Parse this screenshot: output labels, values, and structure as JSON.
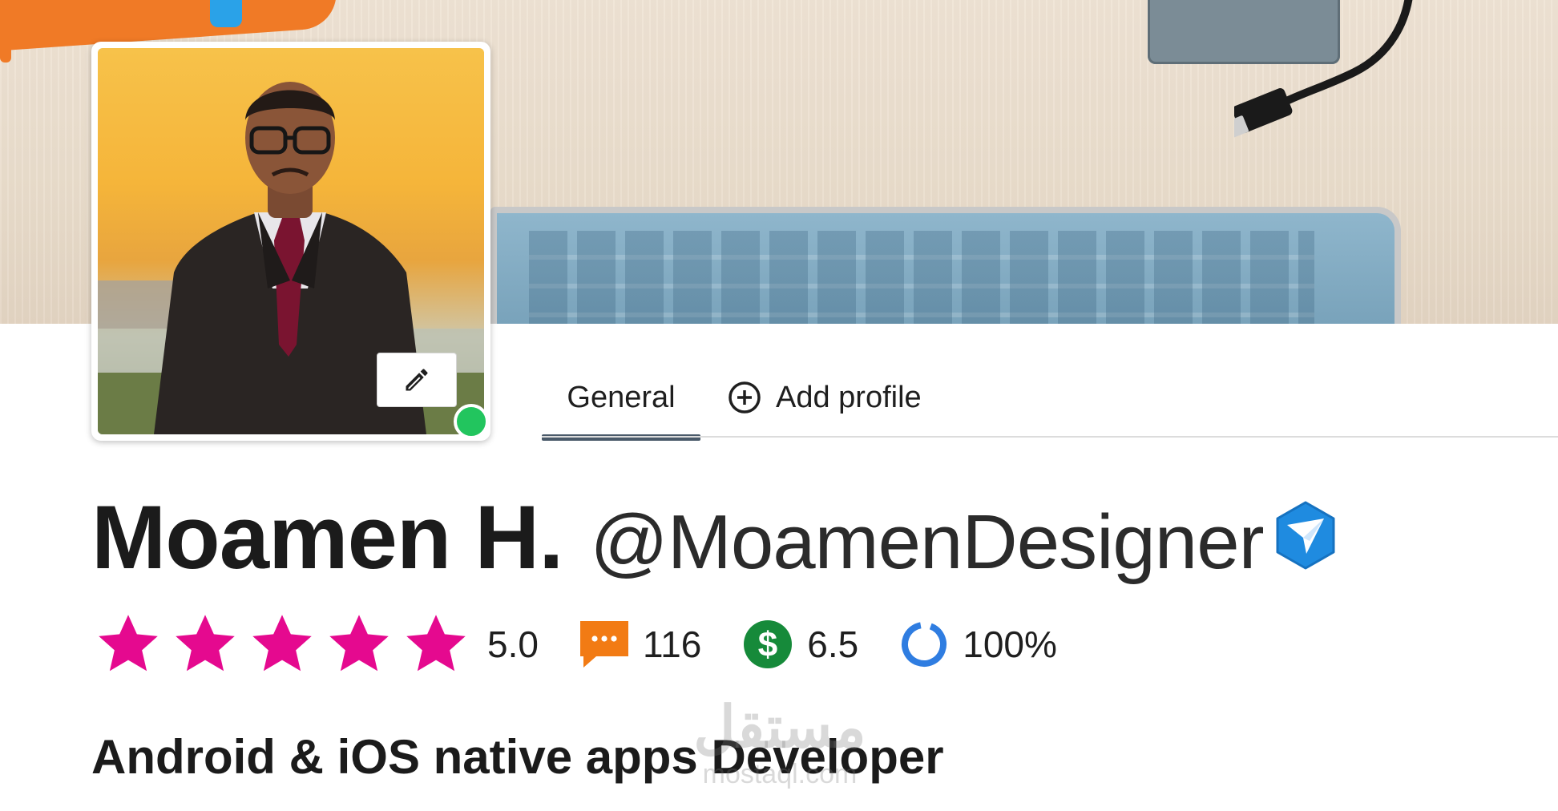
{
  "cover": {
    "name": "cover-photo"
  },
  "avatar": {
    "edit_label": "Edit profile picture",
    "status": "online"
  },
  "tabs": [
    {
      "label": "General",
      "active": true
    },
    {
      "label": "Add profile",
      "icon": "plus-circle-icon",
      "active": false
    }
  ],
  "profile": {
    "name": "Moamen H.",
    "username": "@MoamenDesigner",
    "verified_icon": "verified-badge-icon",
    "headline": "Android & iOS native apps Developer"
  },
  "stats": {
    "rating": {
      "value": "5.0",
      "stars": 5,
      "max_stars": 5,
      "color": "#e5098f"
    },
    "reviews": {
      "value": "116",
      "icon": "comment-icon",
      "color": "#f27b14"
    },
    "earnings": {
      "value": "6.5",
      "icon": "dollar-icon",
      "color": "#168a3a"
    },
    "completion": {
      "value": "100%",
      "icon": "progress-ring-icon",
      "color": "#2f7de1"
    }
  },
  "watermark": {
    "arabic": "مستقل",
    "latin": "mostaql.com"
  }
}
